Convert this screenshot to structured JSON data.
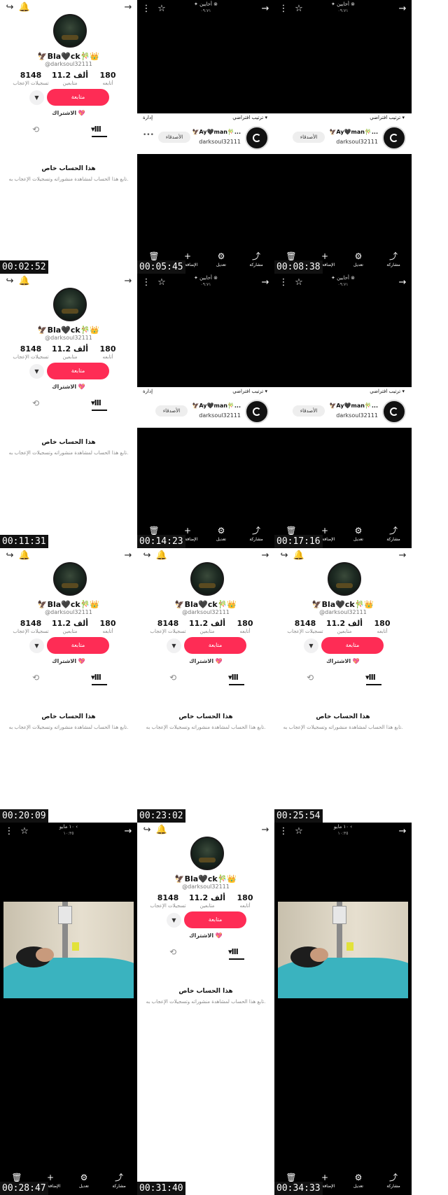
{
  "timestamps": [
    "00:02:52",
    "00:05:45",
    "00:08:38",
    "00:11:31",
    "00:14:23",
    "00:17:16",
    "00:20:09",
    "00:23:02",
    "00:25:54",
    "00:28:47",
    "00:31:40",
    "00:34:33"
  ],
  "profile": {
    "username": "🦅Bla🖤ck🎋👑",
    "handle": "@darksoul32111",
    "stats": [
      {
        "value": "180",
        "label": "أتابعه"
      },
      {
        "value": "11.2 ألف",
        "label": "متابعين"
      },
      {
        "value": "8148",
        "label": "تسجيلات الإعجاب"
      }
    ],
    "follow_label": "متابعة",
    "subscribe_label": "الاشتراك",
    "subscribe_emoji": "💖",
    "private_title": "هذا الحساب خاص",
    "private_desc": "تابع هذا الحساب لمشاهدة منشوراته وتسجيلات الإعجاب به."
  },
  "video_a": {
    "title": "✦ أحايين ⊗",
    "subtitle": "٠٩:٧١",
    "sort_label": "ترتيب افتراضي ▾",
    "manage_label": "إدارة",
    "name": "🦅Ay🖤man🎋...",
    "handle": "darksoul32111",
    "friends_label": "الأصدقاء"
  },
  "video_b": {
    "title": "١٠ مايو ‹",
    "subtitle": "١٠:٣٥"
  },
  "bottom_bar": {
    "share": "مشاركة",
    "edit": "تعديل",
    "add": "الإضافة إلى",
    "delete": ""
  },
  "icons": {
    "share": "share-icon",
    "bell": "bell-icon",
    "arrow": "arrow-right-icon",
    "menu": "more-vert-icon",
    "star": "star-icon",
    "trash": "trash-icon",
    "plus": "plus-icon",
    "sliders": "sliders-icon",
    "grid": "grid-tab-icon",
    "repost": "repost-icon"
  },
  "colors": {
    "accent": "#fe2c55"
  }
}
